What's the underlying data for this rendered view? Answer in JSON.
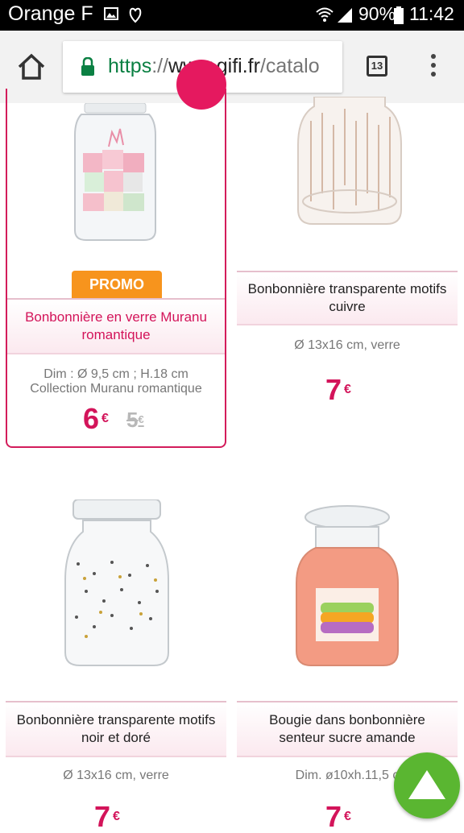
{
  "status_bar": {
    "carrier": "Orange F",
    "battery": "90%",
    "time": "11:42",
    "icons": [
      "image-icon",
      "heart-icon",
      "wifi-icon",
      "signal-icon",
      "battery-icon"
    ]
  },
  "browser": {
    "url_scheme": "https",
    "url_sep": "://",
    "url_domain": "www.gifi.fr",
    "url_path": "/catalo",
    "tab_count": "13",
    "icons": [
      "home-icon",
      "lock-icon",
      "tabs-icon",
      "more-vert-icon"
    ]
  },
  "colors": {
    "accent": "#d3145a",
    "promo_badge": "#f7941d",
    "secure": "#0b8043",
    "scroll_top": "#5ab631"
  },
  "products": [
    {
      "badge": "PROMO",
      "title": "Bonbonnière en verre Muranu romantique",
      "desc_line1": "Dim : Ø 9,5 cm ; H.18 cm",
      "desc_line2": "Collection Muranu romantique",
      "price": "6",
      "old_price": "5",
      "currency": "€"
    },
    {
      "title": "Bonbonnière transparente motifs cuivre",
      "desc_line1": "Ø 13x16 cm, verre",
      "price": "7",
      "currency": "€"
    },
    {
      "title": "Bonbonnière transparente motifs noir et doré",
      "desc_line1": "Ø 13x16 cm, verre",
      "price": "7",
      "currency": "€"
    },
    {
      "title": "Bougie dans bonbonnière senteur sucre amande",
      "desc_line1": "Dim. ø10xh.11,5 c",
      "price": "7",
      "currency": "€"
    }
  ]
}
